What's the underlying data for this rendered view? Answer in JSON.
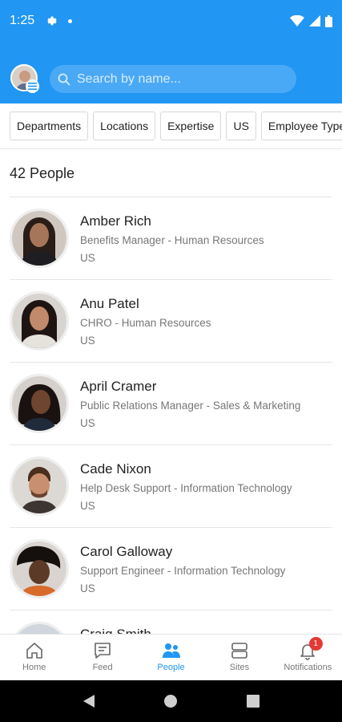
{
  "status": {
    "time": "1:25"
  },
  "search": {
    "placeholder": "Search by name..."
  },
  "filters": [
    "Departments",
    "Locations",
    "Expertise",
    "US",
    "Employee Type"
  ],
  "people_count": "42 People",
  "people": [
    {
      "name": "Amber Rich",
      "title": "Benefits Manager - Human Resources",
      "country": "US"
    },
    {
      "name": "Anu Patel",
      "title": "CHRO - Human Resources",
      "country": "US"
    },
    {
      "name": "April Cramer",
      "title": "Public Relations Manager - Sales & Marketing",
      "country": "US"
    },
    {
      "name": "Cade Nixon",
      "title": "Help Desk Support - Information Technology",
      "country": "US"
    },
    {
      "name": "Carol Galloway",
      "title": "Support Engineer - Information Technology",
      "country": "US"
    },
    {
      "name": "Craig Smith",
      "title": "",
      "country": ""
    }
  ],
  "nav": {
    "home": "Home",
    "feed": "Feed",
    "people": "People",
    "sites": "Sites",
    "notifications": "Notifications",
    "notifications_badge": "1"
  },
  "colors": {
    "brand": "#2196f3",
    "badge": "#e53935"
  }
}
